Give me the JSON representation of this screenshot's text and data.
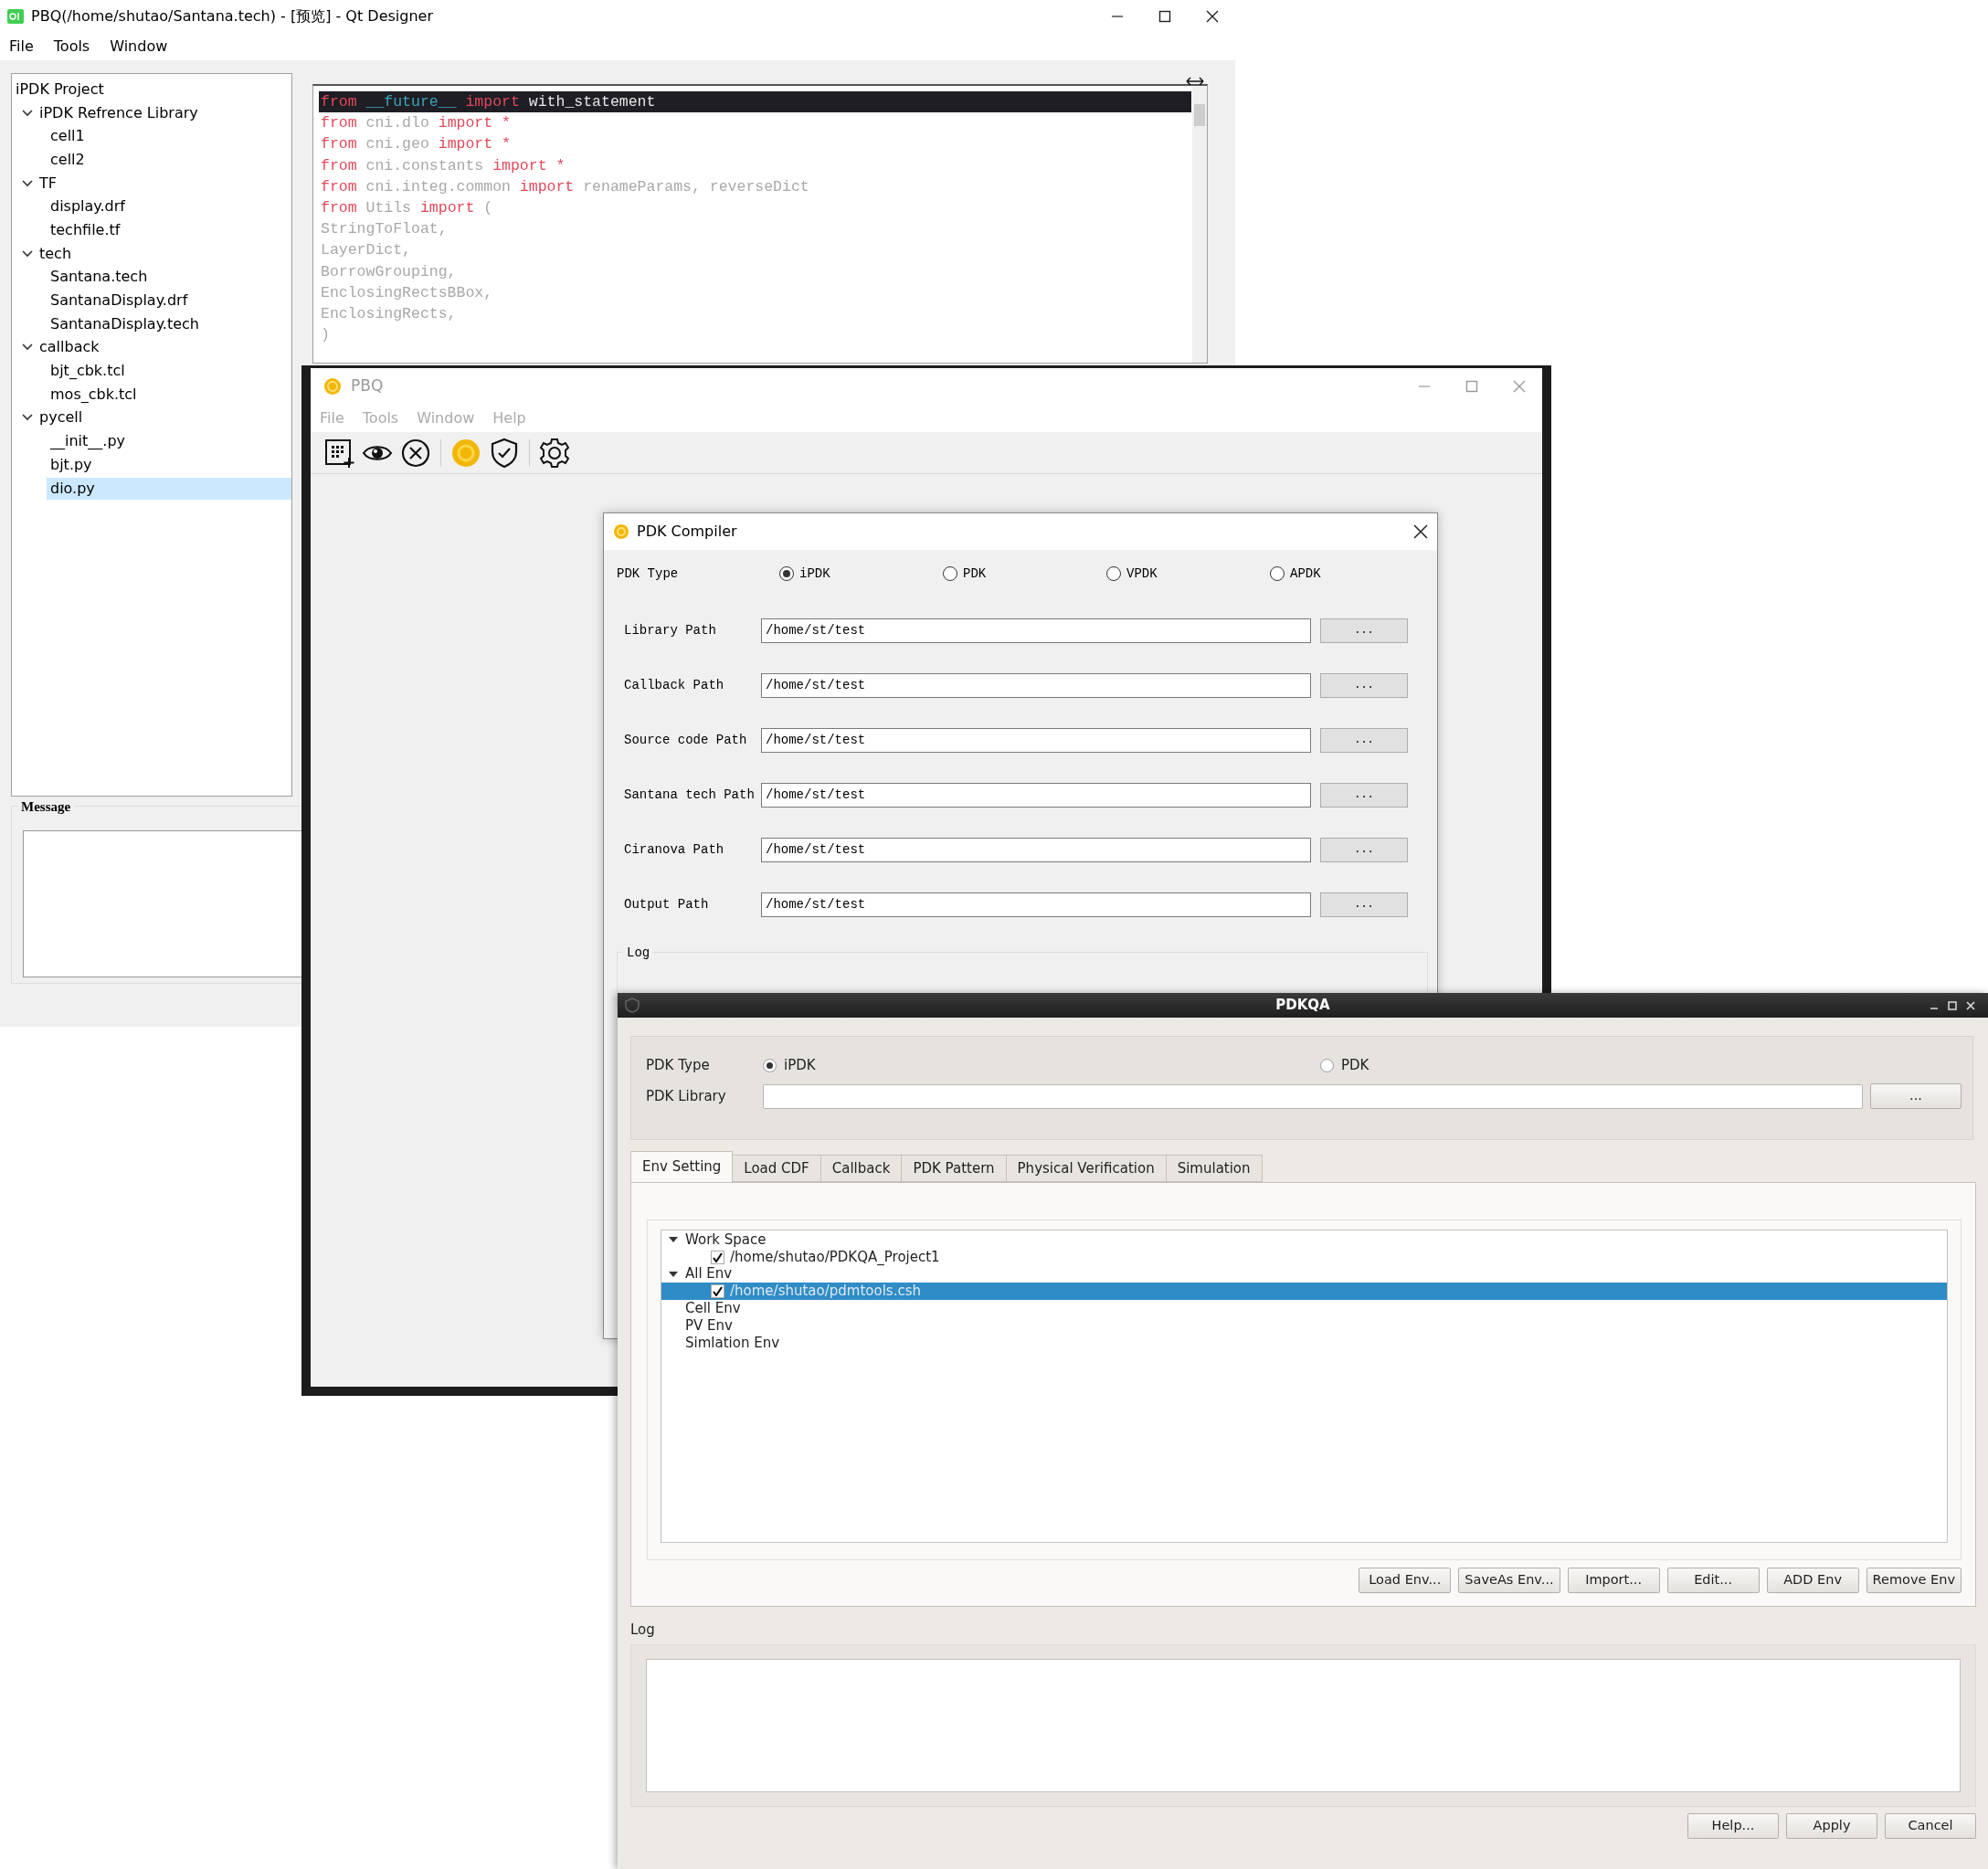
{
  "designer": {
    "title": "PBQ(/home/shutao/Santana.tech) - [预览] - Qt Designer",
    "menu": [
      "File",
      "Tools",
      "Window"
    ],
    "project_tree": {
      "header": "iPDK Project",
      "items": [
        {
          "label": "iPDK Refrence Library",
          "expanded": true,
          "selected": false,
          "children": [
            {
              "label": "cell1",
              "selected": false
            },
            {
              "label": "cell2",
              "selected": false
            }
          ]
        },
        {
          "label": "TF",
          "expanded": true,
          "selected": false,
          "children": [
            {
              "label": "display.drf",
              "selected": false
            },
            {
              "label": "techfile.tf",
              "selected": false
            }
          ]
        },
        {
          "label": "tech",
          "expanded": true,
          "selected": false,
          "children": [
            {
              "label": "Santana.tech",
              "selected": false
            },
            {
              "label": "SantanaDisplay.drf",
              "selected": false
            },
            {
              "label": "SantanaDisplay.tech",
              "selected": false
            }
          ]
        },
        {
          "label": "callback",
          "expanded": true,
          "selected": false,
          "children": [
            {
              "label": "bjt_cbk.tcl",
              "selected": false
            },
            {
              "label": "mos_cbk.tcl",
              "selected": false
            }
          ]
        },
        {
          "label": "pycell",
          "expanded": true,
          "selected": false,
          "children": [
            {
              "label": "__init__.py",
              "selected": false
            },
            {
              "label": "bjt.py",
              "selected": false
            },
            {
              "label": "dio.py",
              "selected": true
            }
          ]
        }
      ]
    },
    "message_title": "Message",
    "code_lines": [
      {
        "current": true,
        "tokens": [
          {
            "kind": "keyword",
            "text": "from"
          },
          {
            "kind": "dunder",
            "text": "__future__"
          },
          {
            "kind": "keyword",
            "text": "import"
          },
          {
            "kind": "name",
            "text": "with_statement"
          }
        ]
      },
      {
        "current": false,
        "tokens": [
          {
            "kind": "keyword",
            "text": "from"
          },
          {
            "kind": "name",
            "text": "cni.dlo"
          },
          {
            "kind": "keyword",
            "text": "import"
          },
          {
            "kind": "keyword",
            "text": "*"
          }
        ]
      },
      {
        "current": false,
        "tokens": [
          {
            "kind": "keyword",
            "text": "from"
          },
          {
            "kind": "name",
            "text": "cni.geo"
          },
          {
            "kind": "keyword",
            "text": "import"
          },
          {
            "kind": "keyword",
            "text": "*"
          }
        ]
      },
      {
        "current": false,
        "tokens": [
          {
            "kind": "keyword",
            "text": "from"
          },
          {
            "kind": "name",
            "text": "cni.constants"
          },
          {
            "kind": "keyword",
            "text": "import"
          },
          {
            "kind": "keyword",
            "text": "*"
          }
        ]
      },
      {
        "current": false,
        "tokens": [
          {
            "kind": "keyword",
            "text": "from"
          },
          {
            "kind": "name",
            "text": "cni.integ.common"
          },
          {
            "kind": "keyword",
            "text": "import"
          },
          {
            "kind": "name",
            "text": "renameParams, reverseDict"
          }
        ]
      },
      {
        "current": false,
        "tokens": [
          {
            "kind": "keyword",
            "text": "from"
          },
          {
            "kind": "name",
            "text": "Utils"
          },
          {
            "kind": "keyword",
            "text": "import"
          },
          {
            "kind": "name",
            "text": "("
          }
        ]
      },
      {
        "current": false,
        "tokens": [
          {
            "kind": "name",
            "text": "StringToFloat,"
          }
        ]
      },
      {
        "current": false,
        "tokens": [
          {
            "kind": "name",
            "text": "LayerDict,"
          }
        ]
      },
      {
        "current": false,
        "tokens": [
          {
            "kind": "name",
            "text": "BorrowGrouping,"
          }
        ]
      },
      {
        "current": false,
        "tokens": [
          {
            "kind": "name",
            "text": "EnclosingRectsBBox,"
          }
        ]
      },
      {
        "current": false,
        "tokens": [
          {
            "kind": "name",
            "text": "EnclosingRects,"
          }
        ]
      },
      {
        "current": false,
        "tokens": [
          {
            "kind": "name",
            "text": ")"
          }
        ]
      }
    ]
  },
  "pbq": {
    "title": "PBQ",
    "menu": [
      "File",
      "Tools",
      "Window",
      "Help"
    ]
  },
  "compiler": {
    "title": "PDK Compiler",
    "type_label": "PDK Type",
    "type_options": [
      {
        "label": "iPDK",
        "selected": true
      },
      {
        "label": "PDK",
        "selected": false
      },
      {
        "label": "VPDK",
        "selected": false
      },
      {
        "label": "APDK",
        "selected": false
      }
    ],
    "fields": [
      {
        "label": "Library Path",
        "value": "/home/st/test",
        "button": "..."
      },
      {
        "label": "Callback Path",
        "value": "/home/st/test",
        "button": "..."
      },
      {
        "label": "Source code Path",
        "value": "/home/st/test",
        "button": "..."
      },
      {
        "label": "Santana tech Path",
        "value": "/home/st/test",
        "button": "..."
      },
      {
        "label": "Ciranova Path",
        "value": "/home/st/test",
        "button": "..."
      },
      {
        "label": "Output Path",
        "value": "/home/st/test",
        "button": "..."
      }
    ],
    "log_title": "Log"
  },
  "pdkqa": {
    "title": "PDKQA",
    "type_label": "PDK Type",
    "type_options": [
      {
        "label": "iPDK",
        "selected": true
      },
      {
        "label": "PDK",
        "selected": false
      }
    ],
    "library_label": "PDK Library",
    "library_button": "...",
    "tabs": [
      {
        "label": "Env Setting",
        "selected": true
      },
      {
        "label": "Load CDF",
        "selected": false
      },
      {
        "label": "Callback",
        "selected": false
      },
      {
        "label": "PDK Pattern",
        "selected": false
      },
      {
        "label": "Physical Verification",
        "selected": false
      },
      {
        "label": "Simulation",
        "selected": false
      }
    ],
    "env_tree": [
      {
        "label": "Work Space",
        "expanded": true,
        "children": [
          {
            "label": "/home/shutao/PDKQA_Project1",
            "checked": true,
            "selected": false
          }
        ]
      },
      {
        "label": "All Env",
        "expanded": true,
        "children": [
          {
            "label": "/home/shutao/pdmtools.csh",
            "checked": true,
            "selected": true
          }
        ]
      },
      {
        "label": "Cell Env"
      },
      {
        "label": "PV Env"
      },
      {
        "label": "Simlation Env"
      }
    ],
    "env_buttons": [
      "Load Env...",
      "SaveAs Env...",
      "Import...",
      "Edit...",
      "ADD Env",
      "Remove Env"
    ],
    "log_label": "Log",
    "dialog_buttons": [
      "Help...",
      "Apply",
      "Cancel"
    ]
  }
}
